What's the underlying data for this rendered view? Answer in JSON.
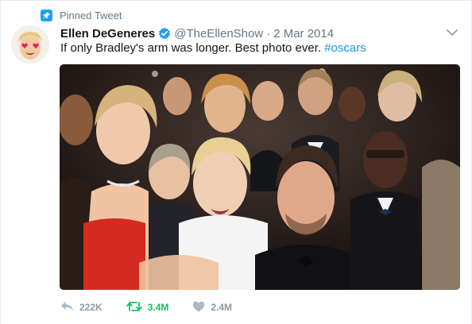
{
  "pinned": {
    "label": "Pinned Tweet"
  },
  "tweet": {
    "name": "Ellen DeGeneres",
    "handle": "@TheEllenShow",
    "separator": "·",
    "date": "2 Mar 2014",
    "text_prefix": "If only Bradley's arm was longer. Best photo ever. ",
    "hashtag": "#oscars"
  },
  "actions": {
    "reply_count": "222K",
    "retweet_count": "3.4M",
    "like_count": "2.4M"
  },
  "icons": {
    "pin": "pin-icon",
    "verified": "verified-badge-icon",
    "caret": "chevron-down-icon",
    "reply": "reply-icon",
    "retweet": "retweet-icon",
    "like": "heart-icon"
  },
  "colors": {
    "link": "#1b95e0",
    "retweet_active": "#17bf63",
    "muted": "#657786",
    "icon_gray": "#8899a6"
  }
}
